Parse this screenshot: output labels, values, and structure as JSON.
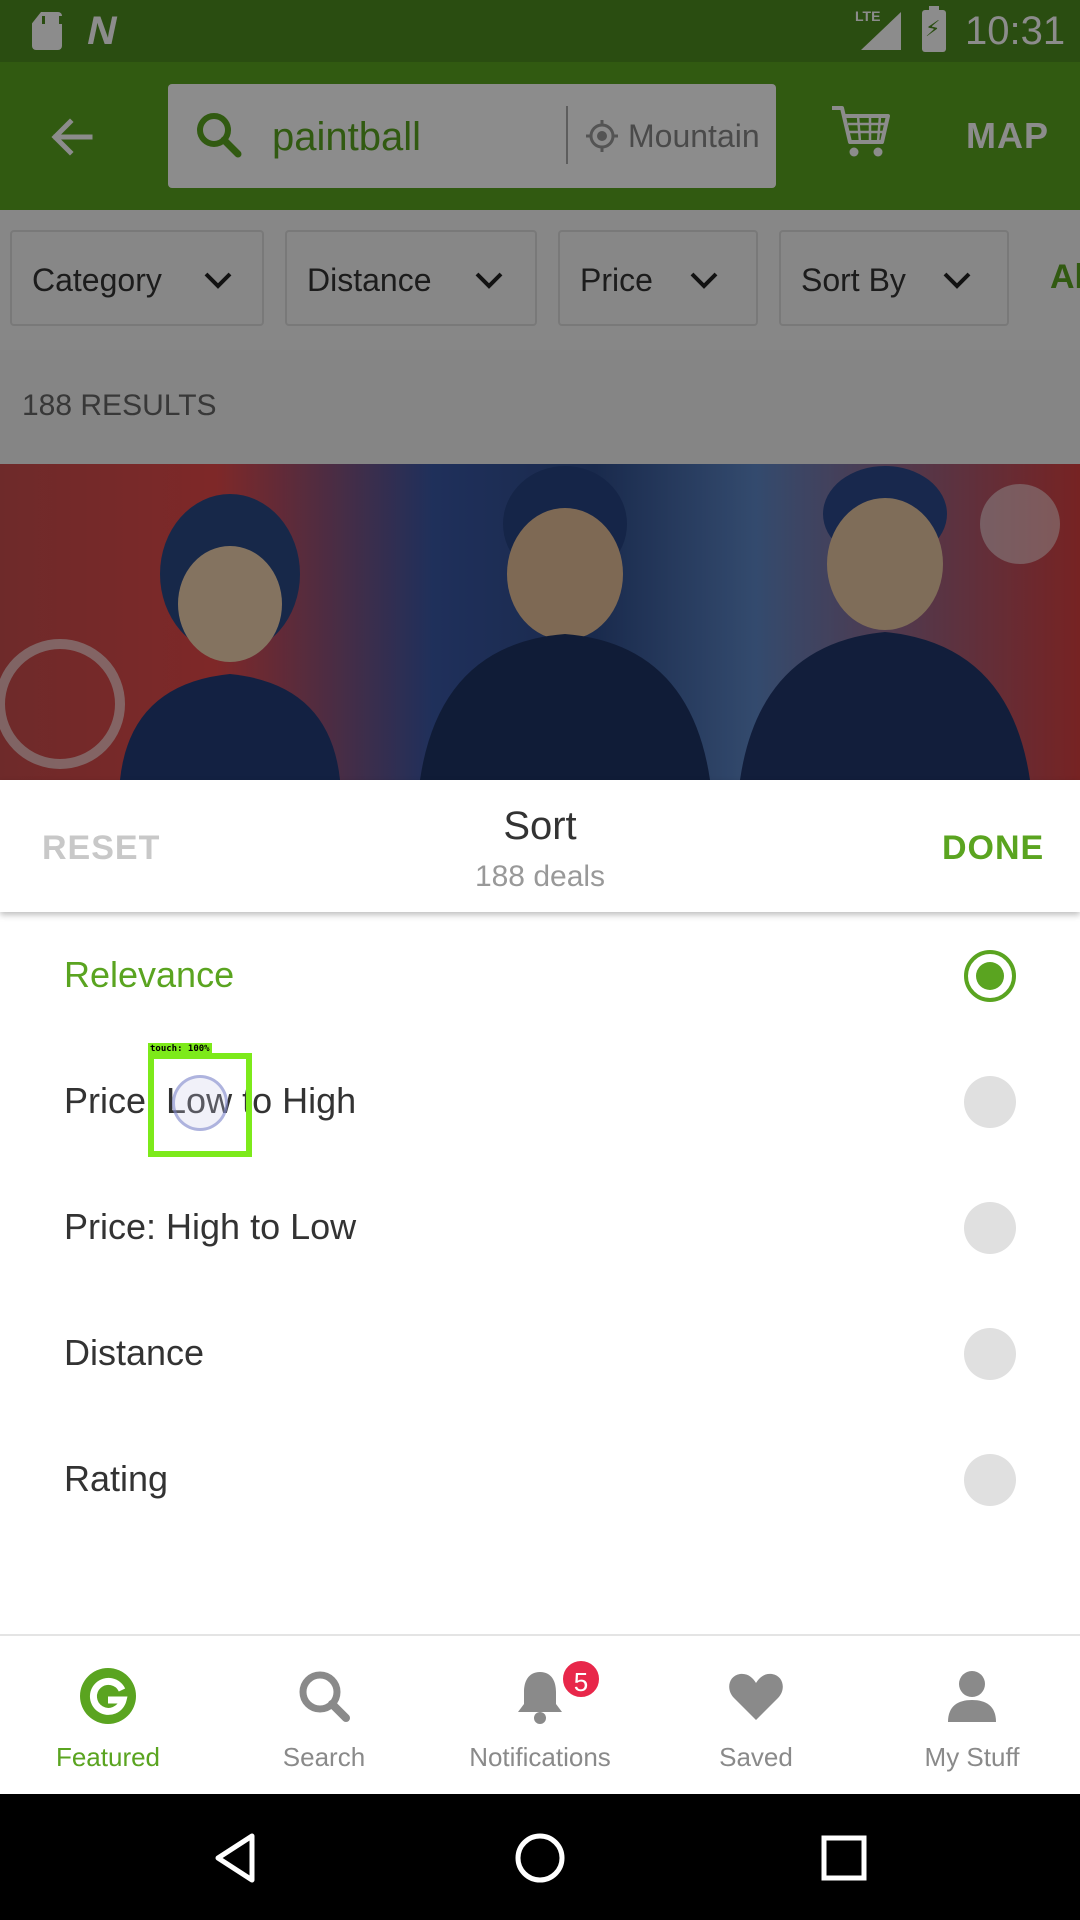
{
  "status_bar": {
    "time": "10:31",
    "network": "LTE"
  },
  "app_bar": {
    "search_query": "paintball",
    "location": "Mountain",
    "map_label": "MAP",
    "icons": [
      "back-arrow-icon",
      "search-icon",
      "location-icon",
      "cart-icon"
    ]
  },
  "filters": {
    "chips": [
      {
        "label": "Category"
      },
      {
        "label": "Distance"
      },
      {
        "label": "Price"
      },
      {
        "label": "Sort By"
      }
    ],
    "overflow_label": "Al"
  },
  "results": {
    "count_text": "188 RESULTS"
  },
  "sort_sheet": {
    "reset_label": "RESET",
    "title": "Sort",
    "subtitle": "188 deals",
    "done_label": "DONE",
    "options": [
      {
        "label": "Relevance",
        "selected": true
      },
      {
        "label": "Price: Low to High",
        "selected": false
      },
      {
        "label": "Price: High to Low",
        "selected": false
      },
      {
        "label": "Distance",
        "selected": false
      },
      {
        "label": "Rating",
        "selected": false
      }
    ]
  },
  "touch_indicator": {
    "label": "touch: 100%"
  },
  "bottom_nav": {
    "items": [
      {
        "label": "Featured",
        "icon": "groupon-g-icon",
        "active": true
      },
      {
        "label": "Search",
        "icon": "search-icon",
        "active": false
      },
      {
        "label": "Notifications",
        "icon": "bell-icon",
        "active": false,
        "badge": "5"
      },
      {
        "label": "Saved",
        "icon": "heart-icon",
        "active": false
      },
      {
        "label": "My Stuff",
        "icon": "person-icon",
        "active": false
      }
    ]
  },
  "colors": {
    "brand_green": "#5aa420",
    "status_green": "#4e8c1f",
    "badge_red": "#e8274a"
  }
}
